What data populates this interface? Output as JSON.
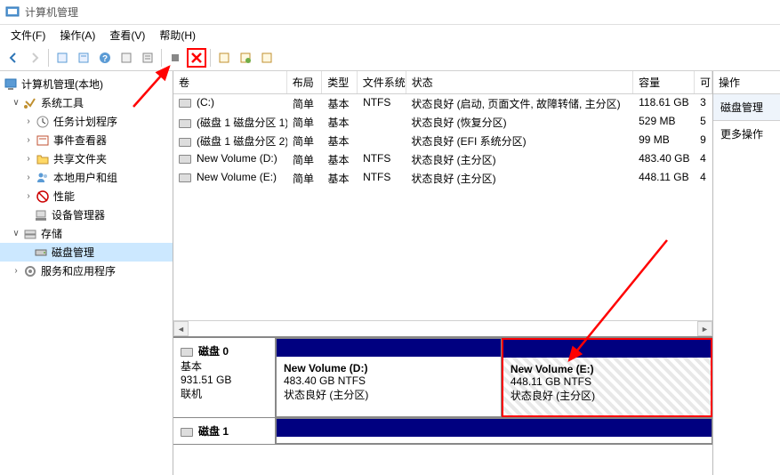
{
  "window": {
    "title": "计算机管理"
  },
  "menu": {
    "file": "文件(F)",
    "action": "操作(A)",
    "view": "查看(V)",
    "help": "帮助(H)"
  },
  "tree": {
    "root": "计算机管理(本地)",
    "system_tools": "系统工具",
    "task_scheduler": "任务计划程序",
    "event_viewer": "事件查看器",
    "shared_folders": "共享文件夹",
    "local_users": "本地用户和组",
    "performance": "性能",
    "device_manager": "设备管理器",
    "storage": "存储",
    "disk_management": "磁盘管理",
    "services": "服务和应用程序"
  },
  "table": {
    "headers": {
      "volume": "卷",
      "layout": "布局",
      "type": "类型",
      "filesystem": "文件系统",
      "status": "状态",
      "capacity": "容量",
      "free": "可"
    },
    "rows": [
      {
        "vol": "(C:)",
        "layout": "简单",
        "type": "基本",
        "fs": "NTFS",
        "status": "状态良好 (启动, 页面文件, 故障转储, 主分区)",
        "cap": "118.61 GB",
        "free": "3"
      },
      {
        "vol": "(磁盘 1 磁盘分区 1)",
        "layout": "简单",
        "type": "基本",
        "fs": "",
        "status": "状态良好 (恢复分区)",
        "cap": "529 MB",
        "free": "5"
      },
      {
        "vol": "(磁盘 1 磁盘分区 2)",
        "layout": "简单",
        "type": "基本",
        "fs": "",
        "status": "状态良好 (EFI 系统分区)",
        "cap": "99 MB",
        "free": "9"
      },
      {
        "vol": "New Volume (D:)",
        "layout": "简单",
        "type": "基本",
        "fs": "NTFS",
        "status": "状态良好 (主分区)",
        "cap": "483.40 GB",
        "free": "4"
      },
      {
        "vol": "New Volume (E:)",
        "layout": "简单",
        "type": "基本",
        "fs": "NTFS",
        "status": "状态良好 (主分区)",
        "cap": "448.11 GB",
        "free": "4"
      }
    ]
  },
  "disk0": {
    "name": "磁盘 0",
    "type": "基本",
    "size": "931.51 GB",
    "status": "联机",
    "part_d": {
      "name": "New Volume  (D:)",
      "size": "483.40 GB NTFS",
      "status": "状态良好 (主分区)"
    },
    "part_e": {
      "name": "New Volume  (E:)",
      "size": "448.11 GB NTFS",
      "status": "状态良好 (主分区)"
    }
  },
  "disk1": {
    "name": "磁盘 1"
  },
  "actions": {
    "header": "操作",
    "group": "磁盘管理",
    "more": "更多操作"
  }
}
